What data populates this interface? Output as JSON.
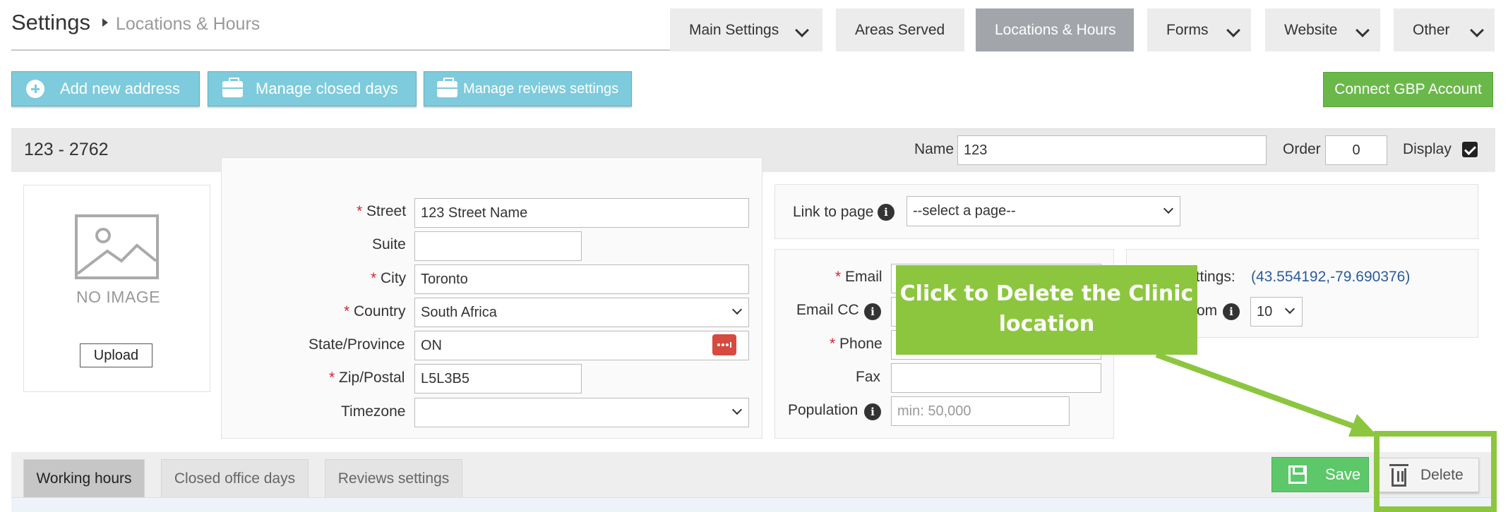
{
  "header": {
    "title": "Settings",
    "breadcrumb": "Locations & Hours",
    "tabs": [
      {
        "label": "Main Settings",
        "dropdown": true
      },
      {
        "label": "Areas Served",
        "dropdown": false
      },
      {
        "label": "Locations & Hours",
        "dropdown": false,
        "active": true
      },
      {
        "label": "Forms",
        "dropdown": true
      },
      {
        "label": "Website",
        "dropdown": true
      },
      {
        "label": "Other",
        "dropdown": true
      }
    ]
  },
  "actions": {
    "add_address": "Add new address",
    "manage_closed_days": "Manage closed days",
    "manage_reviews": "Manage reviews settings",
    "connect_gbp": "Connect GBP Account"
  },
  "location": {
    "title": "123 - 2762",
    "name_label": "Name",
    "name_value": "123",
    "order_label": "Order",
    "order_value": "0",
    "display_label": "Display",
    "display_checked": true
  },
  "image": {
    "no_image_text": "NO IMAGE",
    "upload_label": "Upload"
  },
  "address": {
    "street_label": "Street",
    "street_value": "123 Street Name",
    "suite_label": "Suite",
    "suite_value": "",
    "city_label": "City",
    "city_value": "Toronto",
    "country_label": "Country",
    "country_value": "South Africa",
    "state_label": "State/Province",
    "state_value": "ON",
    "zip_label": "Zip/Postal",
    "zip_value": "L5L3B5",
    "timezone_label": "Timezone",
    "timezone_value": ""
  },
  "link": {
    "label": "Link to page",
    "value": "--select a page--"
  },
  "contact": {
    "email_label": "Email",
    "email_cc_label": "Email CC",
    "phone_label": "Phone",
    "fax_label": "Fax",
    "population_label": "Population",
    "population_placeholder": "min: 50,000"
  },
  "map": {
    "settings_label": "ettings:",
    "coords": "(43.554192,-79.690376)",
    "zoom_label": "om",
    "zoom_value": "10"
  },
  "callout": {
    "line1": "Click to Delete the Clinic",
    "line2": "location"
  },
  "bottom_tabs": [
    "Working hours",
    "Closed office days",
    "Reviews settings"
  ],
  "buttons": {
    "save": "Save",
    "delete": "Delete"
  },
  "colors": {
    "accent_blue": "#7dcbdc",
    "gbp_green": "#6bb84a",
    "callout_green": "#8cc63f",
    "save_green": "#5cc86a",
    "active_tab": "#a2a6ab",
    "required": "#d9232d",
    "coords_link": "#2a5b9a"
  }
}
